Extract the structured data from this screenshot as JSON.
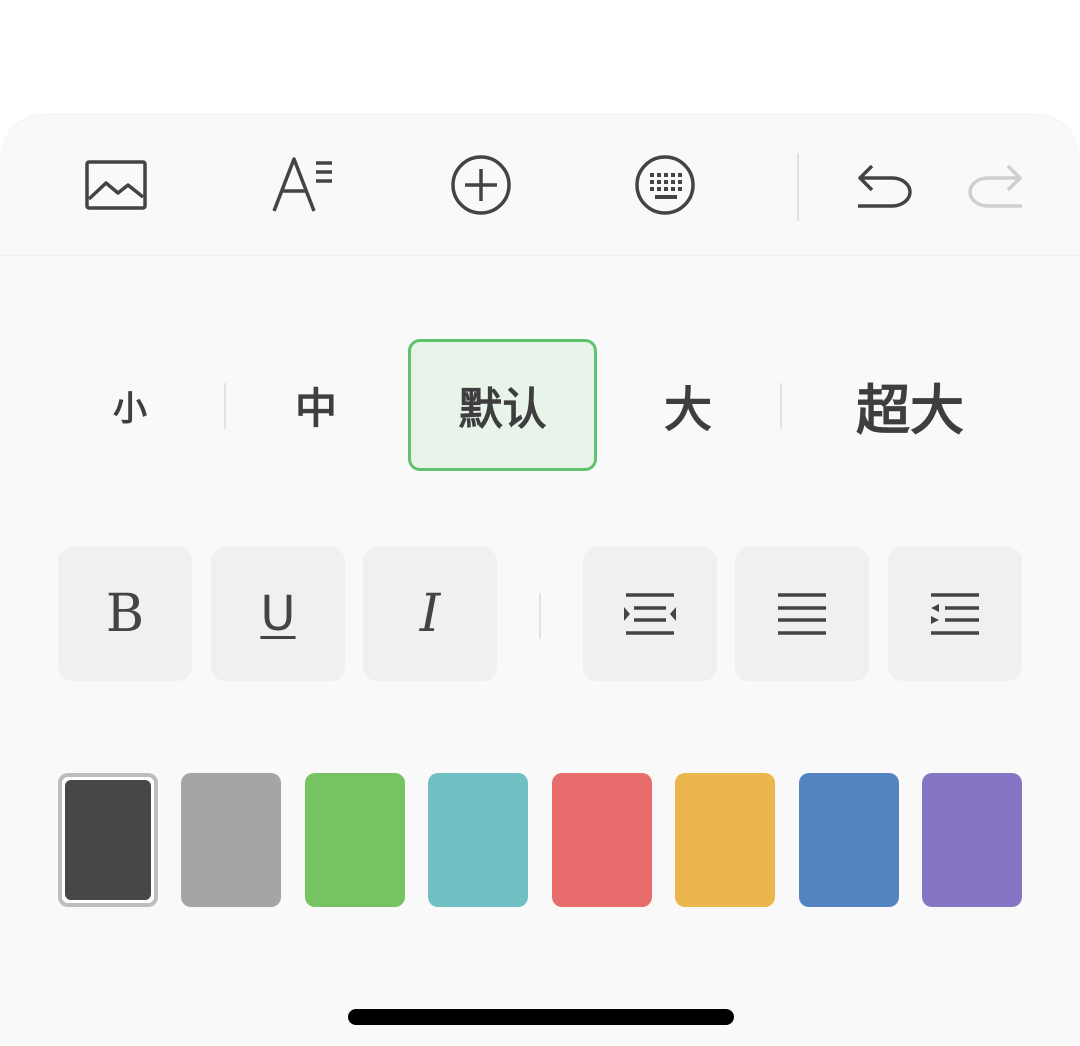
{
  "toolbar": {
    "icons": [
      "image-icon",
      "text-format-icon",
      "add-circle-icon",
      "keyboard-icon",
      "undo-icon",
      "redo-icon"
    ]
  },
  "font_sizes": {
    "options": [
      "小",
      "中",
      "默认",
      "大",
      "超大"
    ],
    "selected": "默认"
  },
  "format": {
    "bold": "B",
    "underline": "U",
    "italic": "I",
    "icons": [
      "bold-icon",
      "underline-icon",
      "italic-icon",
      "indent-icon",
      "align-justify-icon",
      "outdent-icon"
    ]
  },
  "colors": {
    "swatches": [
      "#474747",
      "#a5a5a5",
      "#76c361",
      "#70bfc2",
      "#e96c6d",
      "#ecb64e",
      "#5483c2",
      "#8674c5"
    ],
    "selected": "#474747"
  },
  "theme": {
    "accent": "#5ec36c",
    "icon": "#444444",
    "icon_disabled": "#cfcfcf"
  }
}
